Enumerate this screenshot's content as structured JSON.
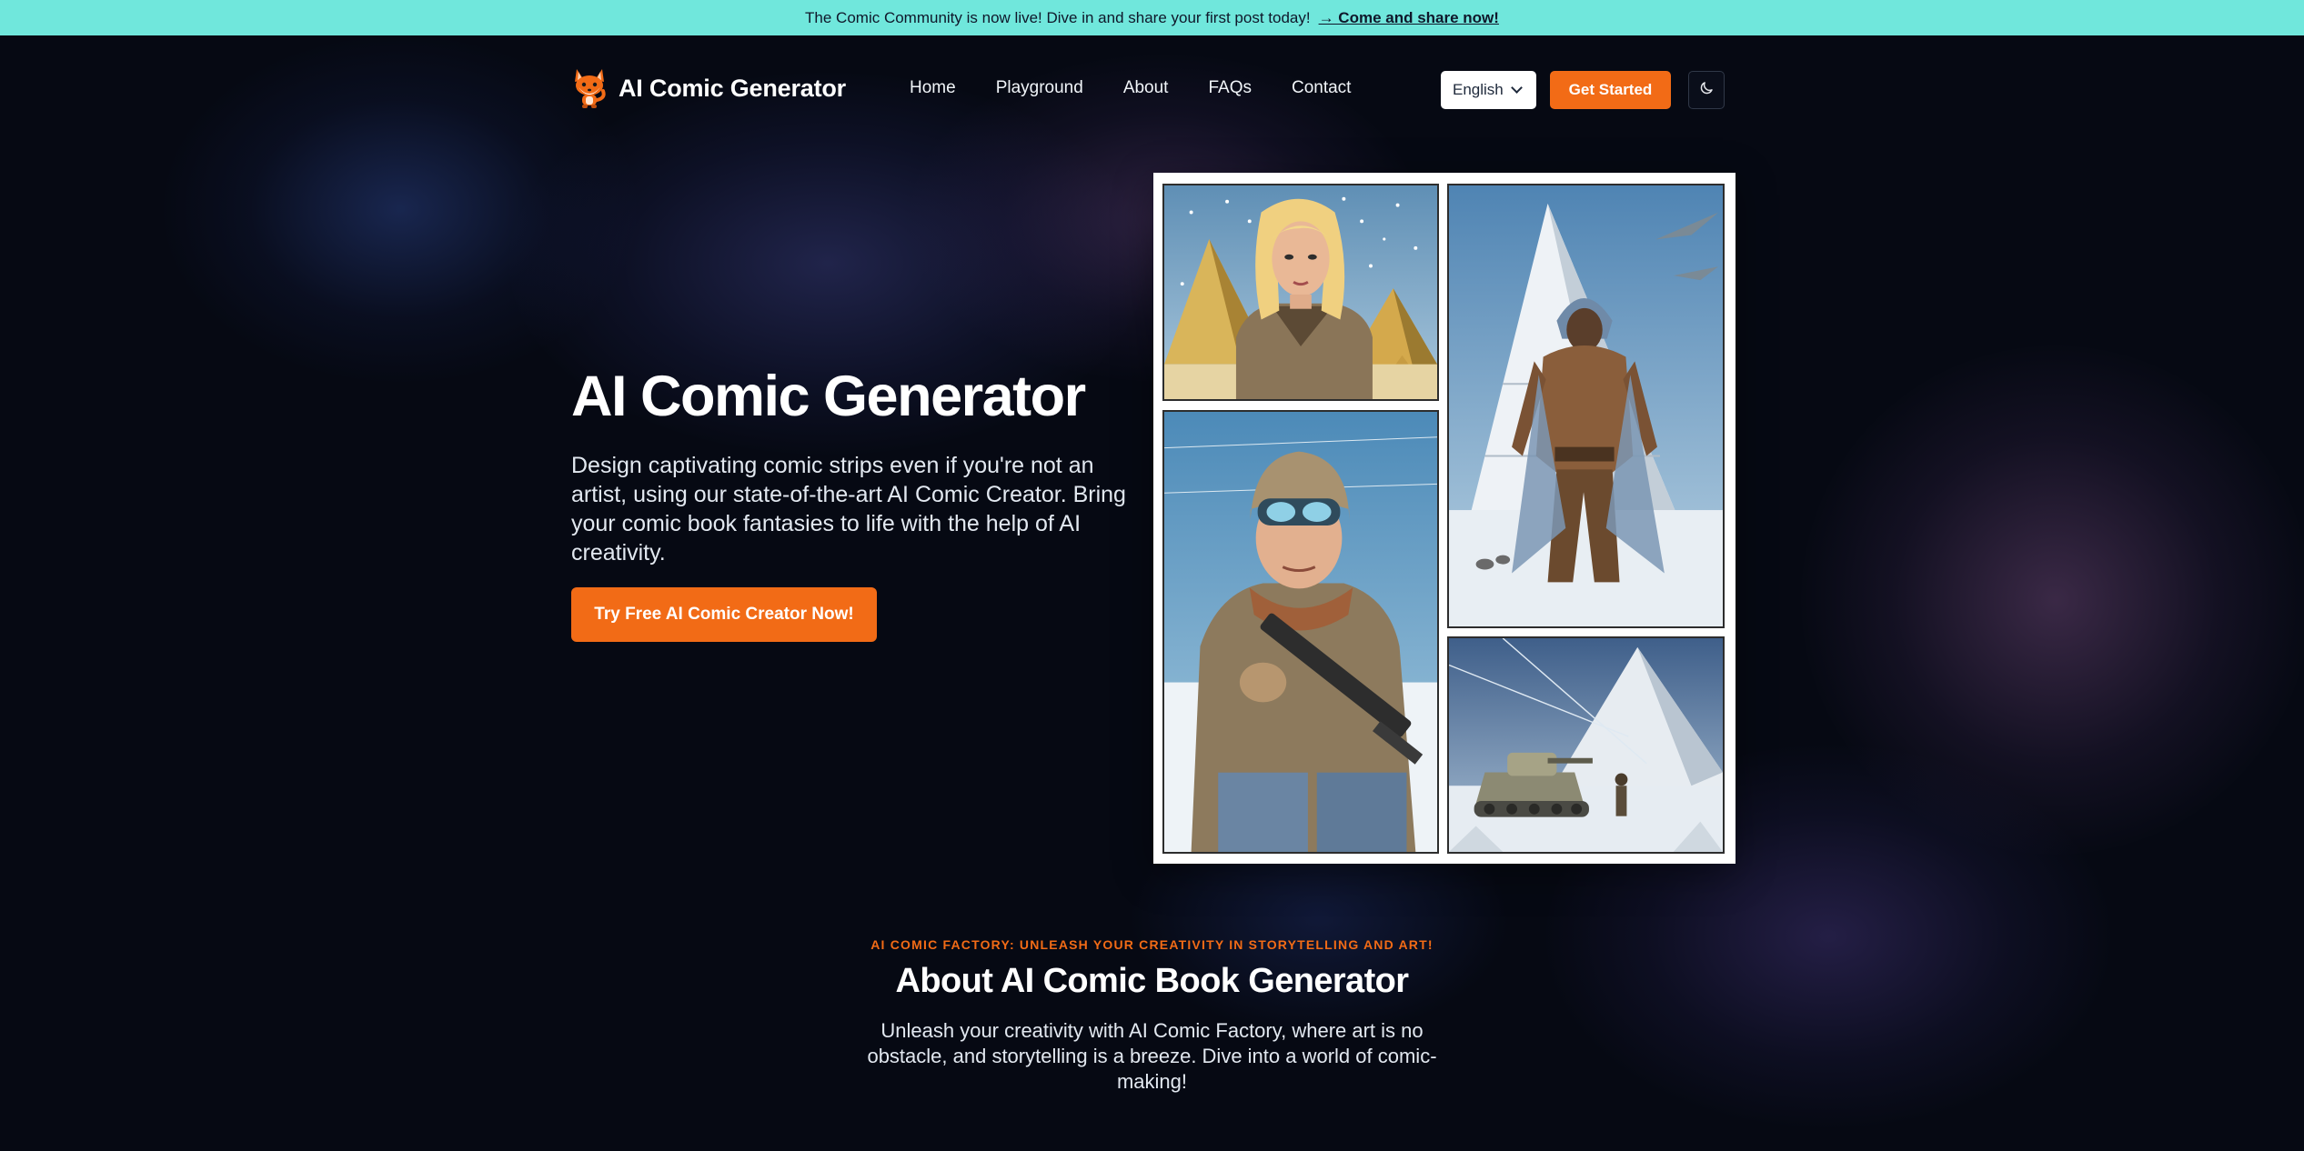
{
  "announcement": {
    "text": "The Comic Community is now live! Dive in and share your first post today!",
    "link_label": "→ Come and share now!"
  },
  "brand": {
    "name": "AI Comic Generator",
    "logo_icon": "fox-mascot-icon"
  },
  "nav": {
    "items": [
      {
        "label": "Home"
      },
      {
        "label": "Playground"
      },
      {
        "label": "About"
      },
      {
        "label": "FAQs"
      },
      {
        "label": "Contact"
      }
    ]
  },
  "header": {
    "language": "English",
    "get_started_label": "Get Started",
    "theme_icon": "moon-icon"
  },
  "hero": {
    "title": "AI Comic Generator",
    "description": "Design captivating comic strips even if you're not an artist, using our state-of-the-art AI Comic Creator. Bring your comic book fantasies to life with the help of AI creativity.",
    "cta_label": "Try Free AI Comic Creator Now!"
  },
  "about": {
    "eyebrow": "AI COMIC FACTORY: UNLEASH YOUR CREATIVITY IN STORYTELLING AND ART!",
    "title": "About AI Comic Book Generator",
    "description": "Unleash your creativity with AI Comic Factory, where art is no obstacle, and storytelling is a breeze. Dive into a world of comic-making!"
  },
  "colors": {
    "background": "#060913",
    "announcement_bg": "#70e7dc",
    "accent": "#f26b16"
  }
}
